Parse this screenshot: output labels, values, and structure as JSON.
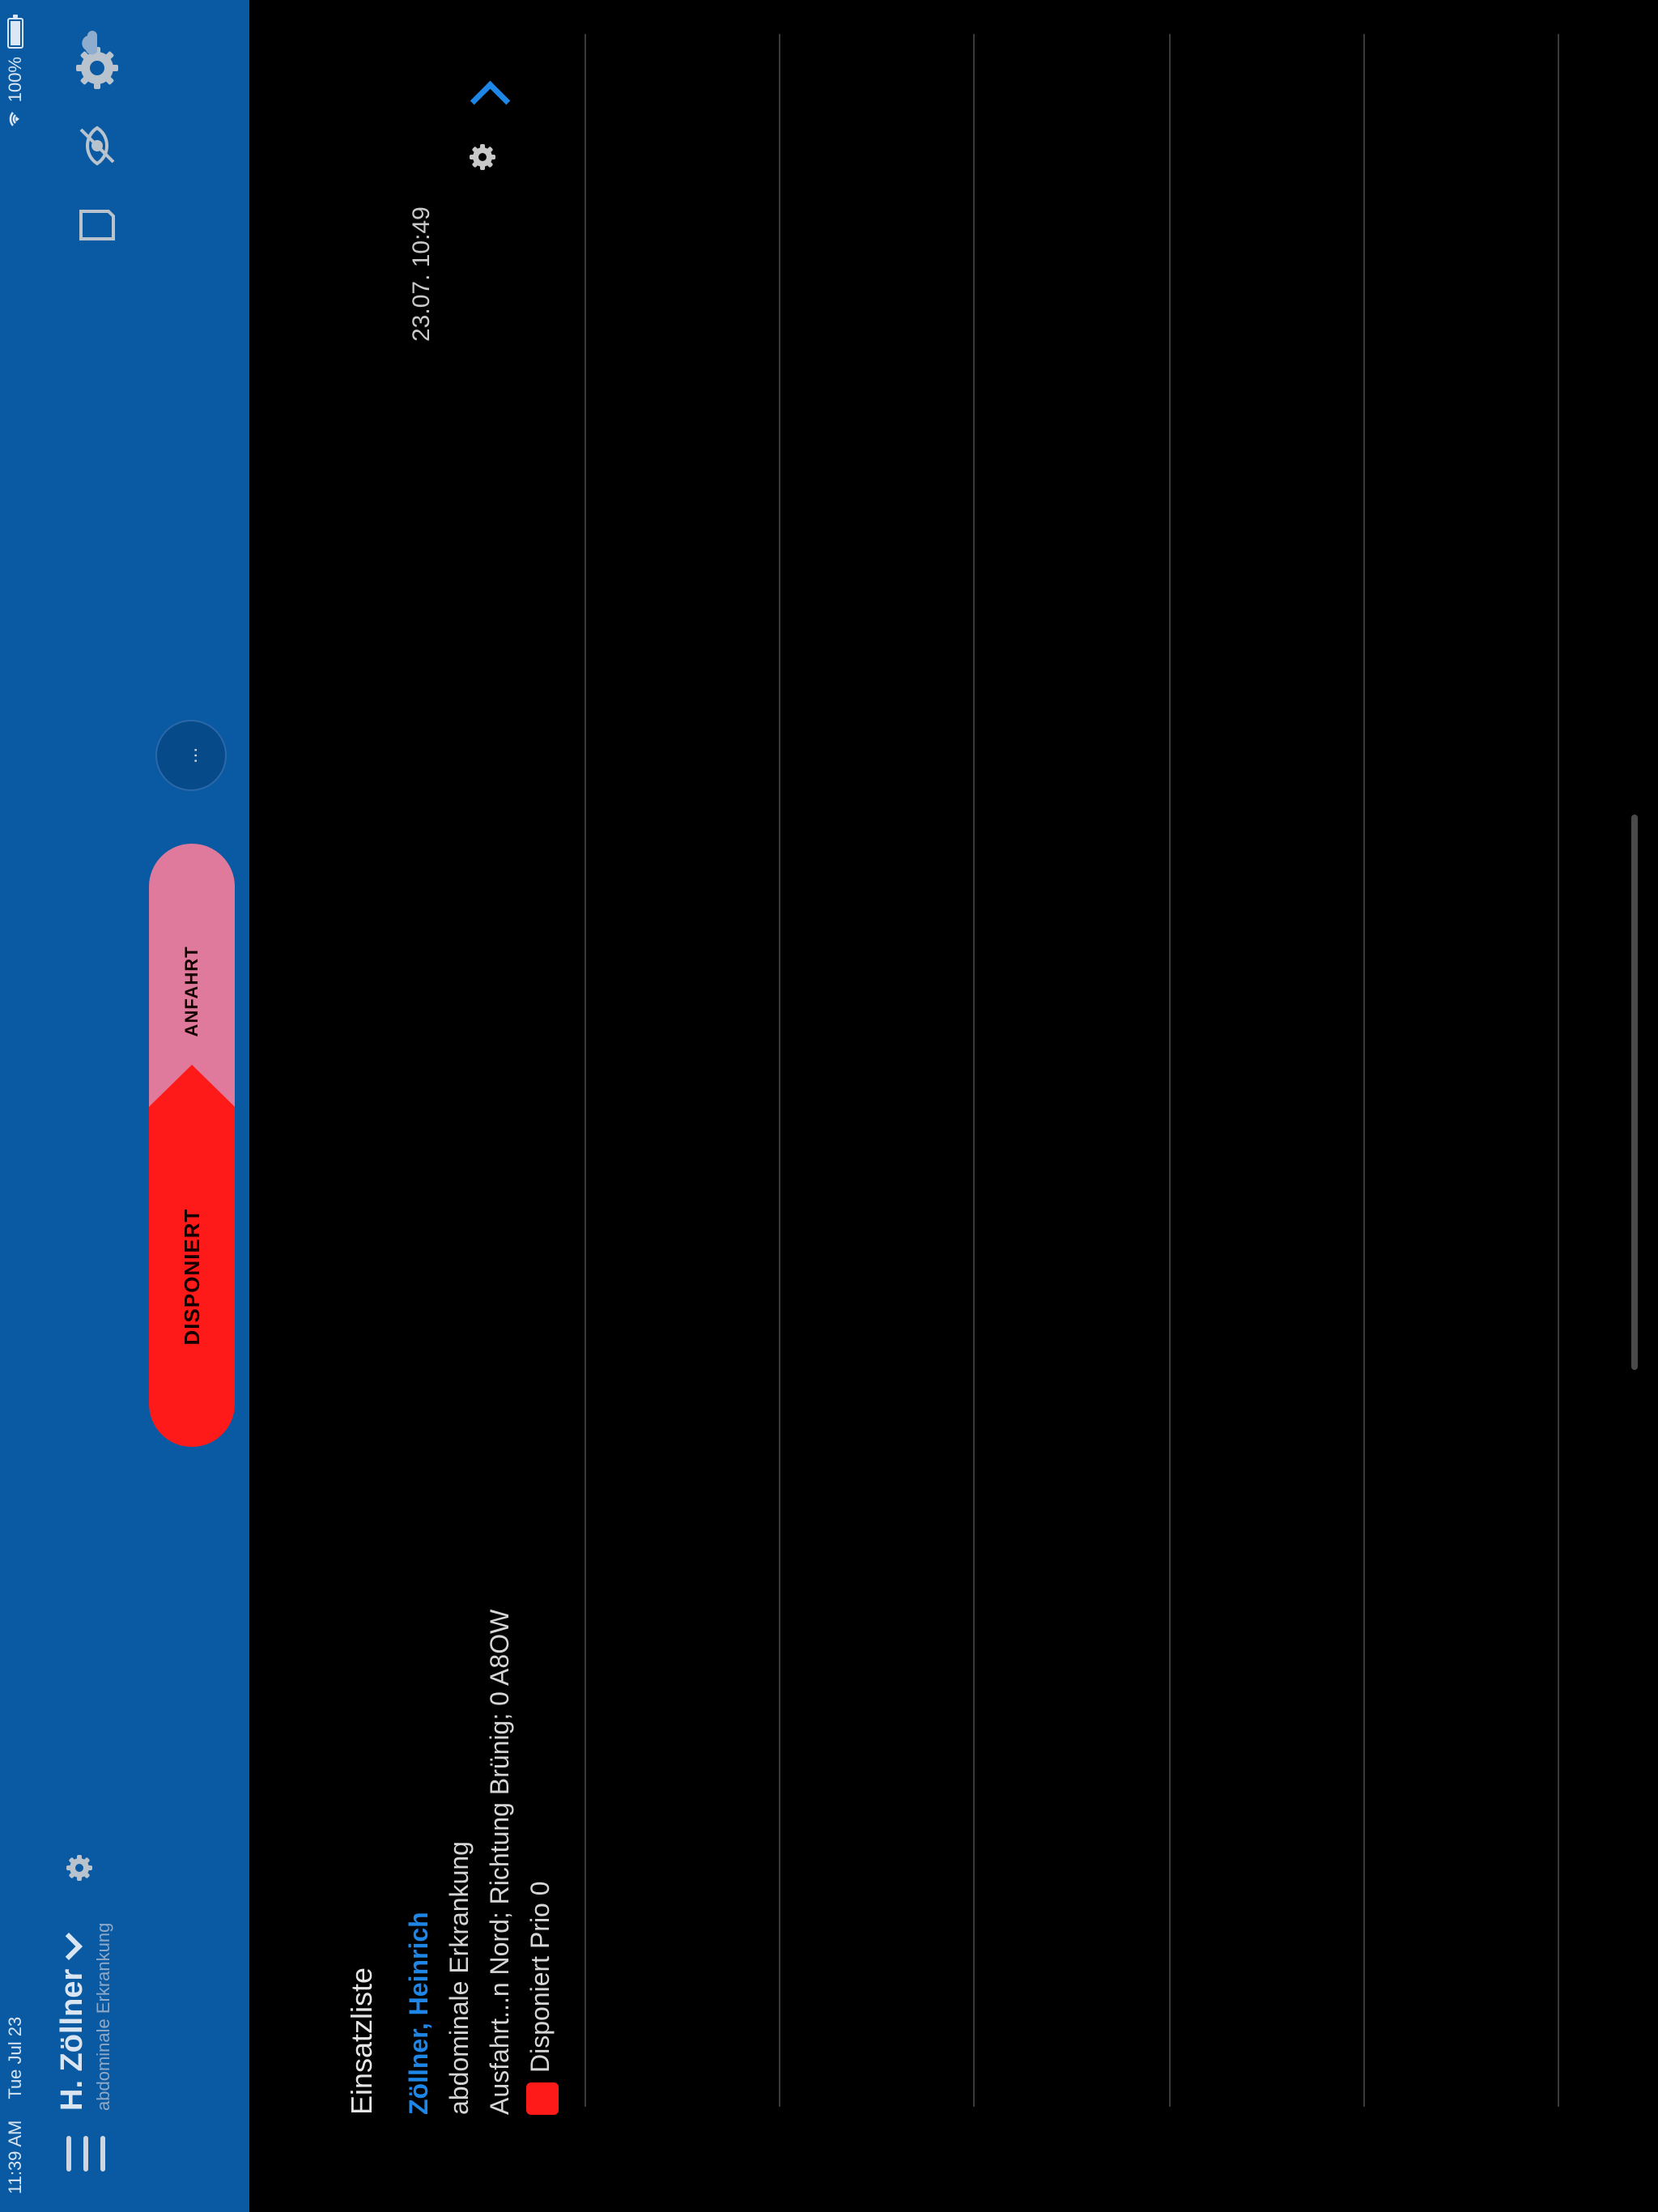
{
  "status_bar": {
    "time": "11:39 AM",
    "date": "Tue Jul 23",
    "battery": "100%"
  },
  "header": {
    "patient_name": "H. Zöllner",
    "patient_diagnosis": "abdominale Erkrankung",
    "timeline": {
      "step1": "DISPONIERT",
      "step2": "ANFAHRT"
    },
    "more_button": "..."
  },
  "list": {
    "title": "Einsatzliste",
    "items": [
      {
        "name": "Zöllner, Heinrich",
        "diagnosis": "abdominale Erkrankung",
        "location": "Ausfahrt...n Nord; Richtung Brünig; 0 A8OW",
        "status": "Disponiert",
        "priority": "Prio 0",
        "status_color": "#ff1a1a",
        "timestamp": "23.07. 10:49"
      }
    ]
  },
  "colors": {
    "header_bg": "#0a5aa3",
    "accent": "#1e86e6",
    "disponiert": "#ff1a1a",
    "anfahrt": "#e07a9c"
  },
  "icons": [
    "menu-icon",
    "gear-icon",
    "chevron-down-icon",
    "document-icon",
    "visibility-off-icon",
    "settings-icon",
    "chevron-up-icon",
    "wifi-icon",
    "battery-icon",
    "cloud-icon"
  ]
}
